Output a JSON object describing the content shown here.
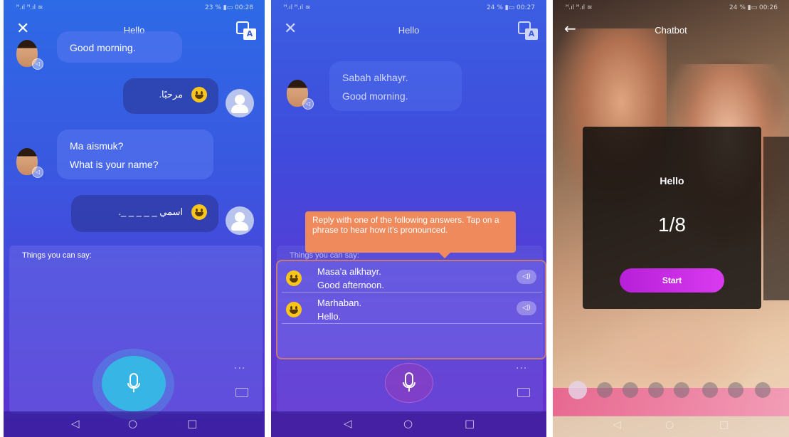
{
  "screen1": {
    "status_left": "ᴴ.ıl ᴴ.ıl ≋",
    "status_right": "23 % ▮▭ 00:28",
    "title": "Hello",
    "messages": [
      {
        "line1": "Good morning.",
        "line2": ""
      },
      {
        "user_text": "مرحبًا."
      },
      {
        "line1": "Ma aismuk?",
        "line2": "What is your name?"
      },
      {
        "user_text": "اسمي _ _ _ _ _."
      }
    ],
    "panel_label": "Things you can say:"
  },
  "screen2": {
    "status_left": "ᴴ.ıl ᴴ.ıl ≋",
    "status_right": "24 % ▮▭ 00:27",
    "title": "Hello",
    "bot_message": {
      "line1": "Sabah alkhayr.",
      "line2": "Good morning."
    },
    "tooltip_text": "Reply with one of the following answers. Tap on a phrase to hear how it's pronounced.",
    "panel_label": "Things you can say:",
    "answers": [
      {
        "line1": "Masa'a alkhayr.",
        "line2": "Good afternoon."
      },
      {
        "line1": "Marhaban.",
        "line2": "Hello."
      }
    ]
  },
  "screen3": {
    "status_left": "ᴴ.ıl ᴴ.ıl ≋",
    "status_right": "24 % ▮▭ 00:26",
    "title": "Chatbot",
    "card_title": "Hello",
    "progress": "1/8",
    "start_label": "Start"
  },
  "icons": {
    "close": "✕",
    "back": "←",
    "speaker": "◁)",
    "nav_back": "◁",
    "nav_home": "○",
    "nav_recent": "□",
    "dots": "···",
    "translate_a": "A"
  }
}
